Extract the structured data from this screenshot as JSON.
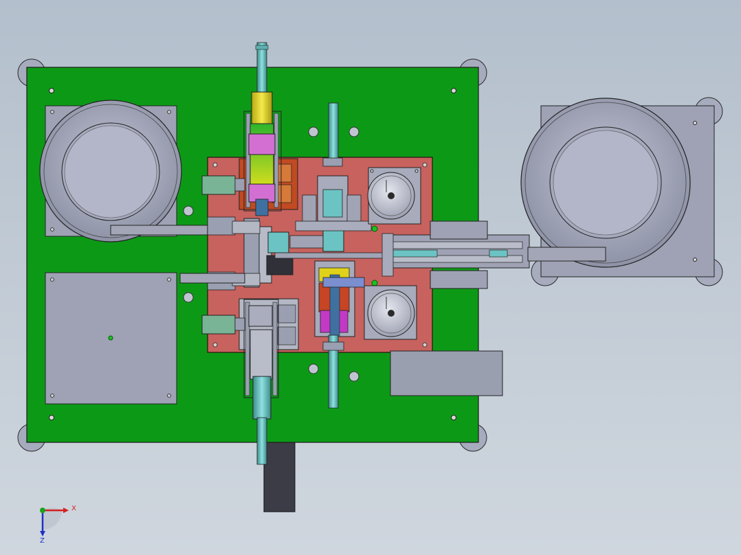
{
  "viewport": {
    "background": [
      "#b3bfcc",
      "#cfd6de"
    ]
  },
  "colors": {
    "base_plate": "#0c9a16",
    "center_plate": "#c7625e",
    "feeder_bowl": "#a9acbf",
    "panel_gray": "#9a9fb0",
    "cylinder_rod": "#6cc3c3",
    "accent_yellow": "#e0d21a",
    "accent_magenta": "#c23ac4"
  },
  "triad": {
    "x_label": "X",
    "z_label": "Z",
    "x_color": "#d62020",
    "y_color": "#1aa31a",
    "z_color": "#2030c8"
  }
}
